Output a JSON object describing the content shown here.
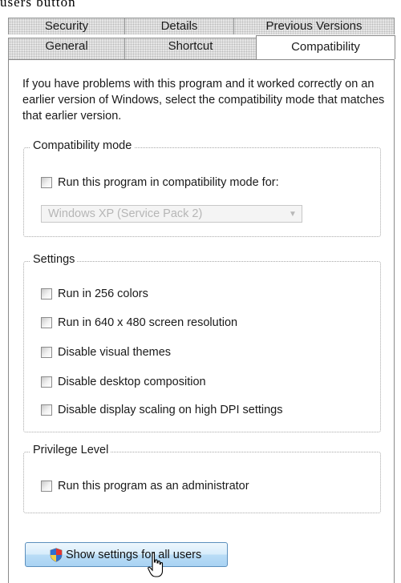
{
  "caption": "users button",
  "tabs": {
    "row_back": [
      {
        "label": "Security"
      },
      {
        "label": "Details"
      },
      {
        "label": "Previous Versions"
      }
    ],
    "row_front": [
      {
        "label": "General"
      },
      {
        "label": "Shortcut"
      },
      {
        "label": "Compatibility",
        "active": true
      }
    ]
  },
  "intro_text": "If you have problems with this program and it worked correctly on an earlier version of Windows, select the compatibility mode that matches that earlier version.",
  "compatibility_mode": {
    "title": "Compatibility mode",
    "checkbox_label": "Run this program in compatibility mode for:",
    "checked": false,
    "select_value": "Windows XP (Service Pack 2)",
    "select_disabled": true
  },
  "settings": {
    "title": "Settings",
    "options": [
      {
        "label": "Run in 256 colors",
        "checked": false
      },
      {
        "label": "Run in 640 x 480 screen resolution",
        "checked": false
      },
      {
        "label": "Disable visual themes",
        "checked": false
      },
      {
        "label": "Disable desktop composition",
        "checked": false
      },
      {
        "label": "Disable display scaling on high DPI settings",
        "checked": false
      }
    ]
  },
  "privilege_level": {
    "title": "Privilege Level",
    "checkbox_label": "Run this program as an administrator",
    "checked": false
  },
  "button": {
    "label": "Show settings for all users",
    "icon": "uac-shield-icon"
  },
  "colors": {
    "button_gradient_top": "#eef7fd",
    "button_gradient_bottom": "#a9d3f3",
    "button_border": "#5b8fbd"
  }
}
